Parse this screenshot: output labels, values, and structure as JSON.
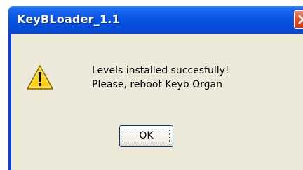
{
  "window": {
    "title": "KeyBLoader_1.1",
    "close_icon": "close-x-icon"
  },
  "dialog": {
    "icon": "warning-icon",
    "message_line1": "Levels installed succesfully!",
    "message_line2": "Please, reboot Keyb Organ",
    "ok_label": "OK"
  },
  "colors": {
    "titlebar": "#0a55e4",
    "close_button": "#e0502a",
    "client_background": "#ece9d8",
    "warning_fill": "#ffd21e",
    "button_border": "#003c74"
  }
}
